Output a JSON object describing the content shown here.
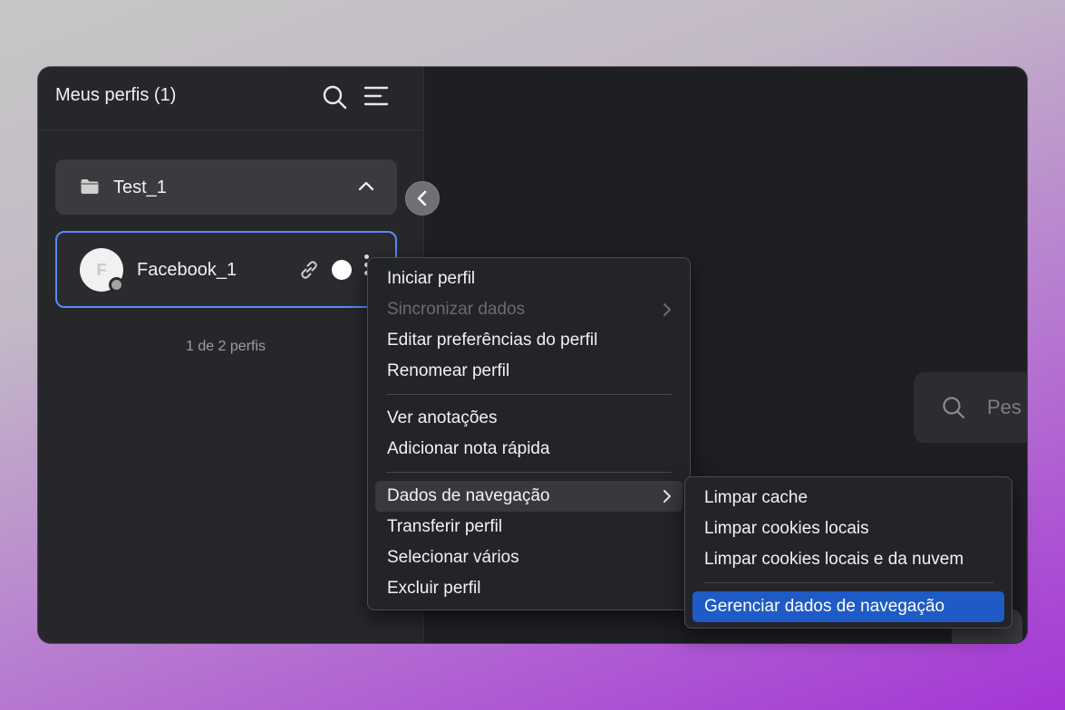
{
  "sidebar": {
    "title": "Meus perfis (1)",
    "folder": {
      "name": "Test_1"
    },
    "profile": {
      "avatar_letter": "F",
      "name": "Facebook_1"
    },
    "count_text": "1 de 2 perfis"
  },
  "main": {
    "search_placeholder": "Pes"
  },
  "context_menu": {
    "items": [
      {
        "label": "Iniciar perfil"
      },
      {
        "label": "Sincronizar dados",
        "disabled": true,
        "submenu": true
      },
      {
        "label": "Editar preferências do perfil"
      },
      {
        "label": "Renomear perfil"
      },
      {
        "label": "Ver anotações"
      },
      {
        "label": "Adicionar nota rápida"
      },
      {
        "label": "Dados de navegação",
        "submenu": true,
        "active": true
      },
      {
        "label": "Transferir perfil"
      },
      {
        "label": "Selecionar vários"
      },
      {
        "label": "Excluir perfil"
      }
    ]
  },
  "submenu": {
    "items": [
      {
        "label": "Limpar cache"
      },
      {
        "label": "Limpar cookies locais"
      },
      {
        "label": "Limpar cookies locais e da nuvem"
      },
      {
        "label": "Gerenciar dados de navegação",
        "selected": true
      }
    ]
  },
  "colors": {
    "accent": "#5b8af5",
    "selected": "#1e5bc6"
  }
}
